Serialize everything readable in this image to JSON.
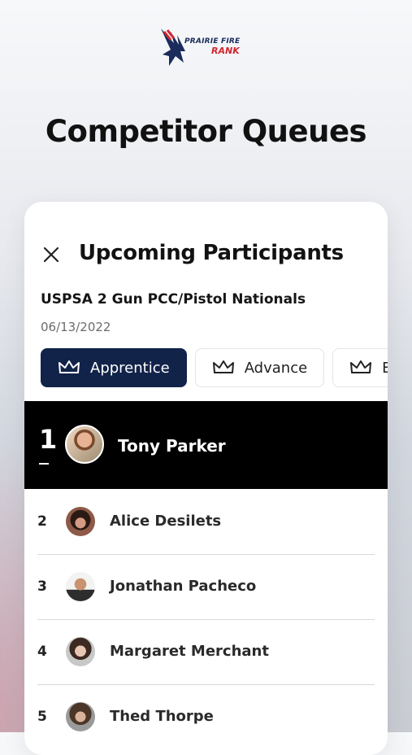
{
  "brand": {
    "line1": "PRAIRIE FIRE",
    "line2": "RANK",
    "primary": "#1a2b5c",
    "accent": "#d0262f"
  },
  "headline": "Competitor Queues",
  "card": {
    "title": "Upcoming Participants",
    "close_icon": "close-icon",
    "event_name": "USPSA 2 Gun PCC/Pistol Nationals",
    "event_date": "06/13/2022",
    "tabs": [
      {
        "label": "Apprentice",
        "icon": "crown-icon",
        "active": true
      },
      {
        "label": "Advance",
        "icon": "crown-icon",
        "active": false
      },
      {
        "label": "E",
        "icon": "crown-icon",
        "active": false
      }
    ],
    "participants": [
      {
        "rank": "1",
        "name": "Tony Parker"
      },
      {
        "rank": "2",
        "name": "Alice Desilets"
      },
      {
        "rank": "3",
        "name": "Jonathan Pacheco"
      },
      {
        "rank": "4",
        "name": "Margaret Merchant"
      },
      {
        "rank": "5",
        "name": "Thed Thorpe"
      }
    ]
  }
}
